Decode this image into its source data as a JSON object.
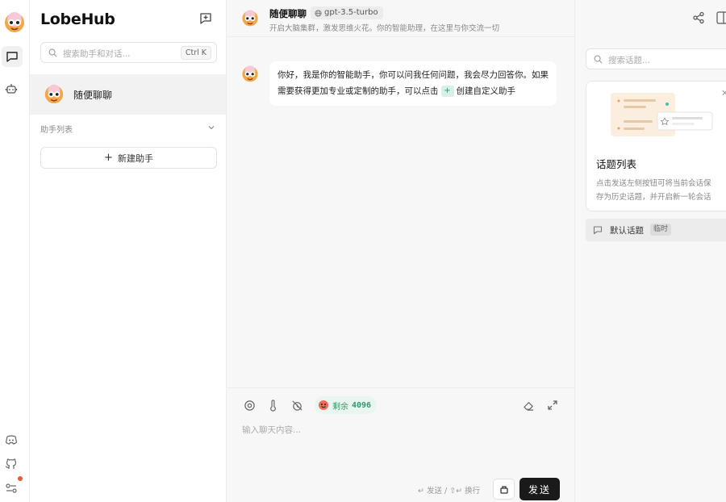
{
  "app": {
    "brand": "LobeHub"
  },
  "sidebar": {
    "search_placeholder": "搜索助手和对话...",
    "search_shortcut": "Ctrl K",
    "session": {
      "name": "随便聊聊"
    },
    "group_label": "助手列表",
    "add_agent_label": "新建助手"
  },
  "chat": {
    "header": {
      "title": "随便聊聊",
      "model": "gpt-3.5-turbo",
      "description": "开启大脑集群，激发思维火花。你的智能助理，在这里与你交流一切"
    },
    "message": {
      "text_before": "你好，我是你的智能助手，你可以问我任何问题，我会尽力回答你。如果需要获得更加专业或定制的助手，可以点击",
      "chip": "+",
      "text_after": "创建自定义助手"
    },
    "input": {
      "tokens_label": "剩余",
      "tokens_value": "4096",
      "placeholder": "输入聊天内容...",
      "hint": "↵ 发送 / ⇧↵ 换行",
      "send_label": "发送"
    }
  },
  "topics": {
    "search_placeholder": "搜索话题...",
    "card_title": "话题列表",
    "card_line1": "点击发送左侧按钮可将当前会话保",
    "card_line2": "存为历史话题，并开启新一轮会话",
    "default_topic": "默认话题",
    "default_topic_tag": "临时"
  },
  "colors": {
    "accent_green": "#2e9a6b",
    "send_bg": "#1a1a1a",
    "badge_red": "#ef5b3a"
  },
  "icons": [
    "app-logo-icon",
    "chat-icon",
    "bot-icon",
    "discord-icon",
    "github-icon",
    "settings-icon",
    "new-chat-icon",
    "search-icon",
    "chevron-down-icon",
    "plus-icon",
    "globe-icon",
    "share-icon",
    "panel-toggle-icon",
    "brain-icon",
    "thermometer-icon",
    "history-icon",
    "emoji-icon",
    "eraser-icon",
    "expand-icon",
    "stop-icon",
    "topic-icon",
    "close-icon"
  ]
}
